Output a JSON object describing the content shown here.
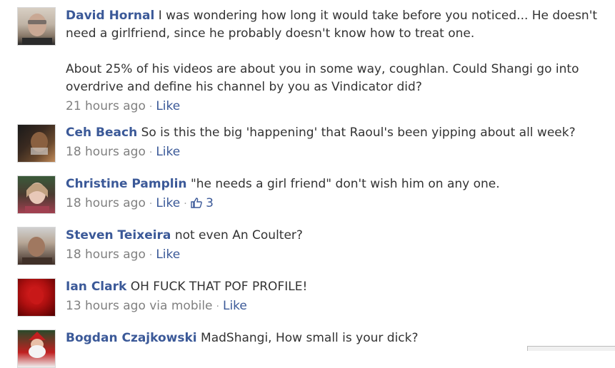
{
  "comments": [
    {
      "author": "David Hornal",
      "text1": "I was wondering how long it would take before you noticed... He doesn't need a girlfriend, since he probably doesn't know how to treat one.",
      "text2": "About 25% of his videos are about you in some way, coughlan. Could Shangi go into overdrive and define his channel by you as Vindicator did?",
      "time": "21 hours ago",
      "like_label": "Like",
      "avatar_colors": [
        "#d8cfc4",
        "#8a7a6a",
        "#2a2a2a"
      ]
    },
    {
      "author": "Ceh Beach",
      "text1": "So is this the big 'happening' that Raoul's been yipping about all week?",
      "time": "18 hours ago",
      "like_label": "Like",
      "avatar_colors": [
        "#1a1a1a",
        "#6b4a2e",
        "#c08a5a"
      ]
    },
    {
      "author": "Christine Pamplin",
      "text1": "\"he needs a girl friend\" don't wish him on any one.",
      "time": "18 hours ago",
      "like_label": "Like",
      "like_count": "3",
      "avatar_colors": [
        "#3a5a3a",
        "#e8c8b8",
        "#a04050"
      ]
    },
    {
      "author": "Steven Teixeira",
      "text1": "not even An Coulter?",
      "time": "18 hours ago",
      "like_label": "Like",
      "avatar_colors": [
        "#d0d0d0",
        "#a07860",
        "#403028"
      ]
    },
    {
      "author": "Ian Clark",
      "text1": "OH FUCK THAT POF PROFILE!",
      "time": "13 hours ago via mobile",
      "like_label": "Like",
      "avatar_colors": [
        "#b01010",
        "#e02020",
        "#500000"
      ]
    },
    {
      "author": "Bogdan Czajkowski",
      "text1": "MadShangi, How small is your dick?",
      "avatar_colors": [
        "#2a4a2a",
        "#c02020",
        "#f0f0f0"
      ]
    }
  ]
}
